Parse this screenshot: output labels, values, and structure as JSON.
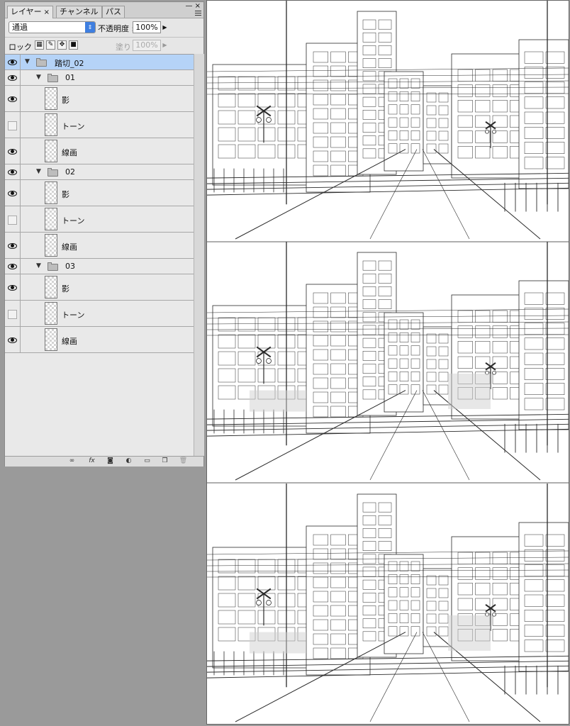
{
  "panel": {
    "tabs": [
      {
        "label": "レイヤー",
        "close": "×"
      },
      {
        "label": "チャンネル"
      },
      {
        "label": "パス"
      }
    ],
    "window_controls": "— ×",
    "blend_mode": "通過",
    "opacity_label": "不透明度 :",
    "opacity_value": "100%",
    "lock_label": "ロック :",
    "fill_label": "塗り :",
    "fill_value": "100%"
  },
  "layers": [
    {
      "name": "踏切_02",
      "kind": "group",
      "visible": true,
      "selected": true,
      "depth": 0
    },
    {
      "name": "01",
      "kind": "group",
      "visible": true,
      "depth": 1
    },
    {
      "name": "影",
      "kind": "layer",
      "visible": true,
      "depth": 2
    },
    {
      "name": "トーン",
      "kind": "layer",
      "visible": false,
      "depth": 2
    },
    {
      "name": "線画",
      "kind": "layer",
      "visible": true,
      "depth": 2
    },
    {
      "name": "02",
      "kind": "group",
      "visible": true,
      "depth": 1
    },
    {
      "name": "影",
      "kind": "layer",
      "visible": true,
      "depth": 2
    },
    {
      "name": "トーン",
      "kind": "layer",
      "visible": false,
      "depth": 2
    },
    {
      "name": "線画",
      "kind": "layer",
      "visible": true,
      "depth": 2
    },
    {
      "name": "03",
      "kind": "group",
      "visible": true,
      "depth": 1
    },
    {
      "name": "影",
      "kind": "layer",
      "visible": true,
      "depth": 2
    },
    {
      "name": "トーン",
      "kind": "layer",
      "visible": false,
      "depth": 2
    },
    {
      "name": "線画",
      "kind": "layer",
      "visible": true,
      "depth": 2
    }
  ],
  "bottom_icons": [
    "link-icon",
    "fx-icon",
    "mask-icon",
    "adjustment-icon",
    "new-group-icon",
    "new-layer-icon",
    "trash-icon"
  ],
  "bottom_icon_glyphs": {
    "fx": "fx"
  },
  "canvas": {
    "content": "three railway crossing line drawings",
    "colors": {
      "line": "#2a2a2a",
      "paper": "#ffffff",
      "tone": "#cfcfcf"
    }
  }
}
